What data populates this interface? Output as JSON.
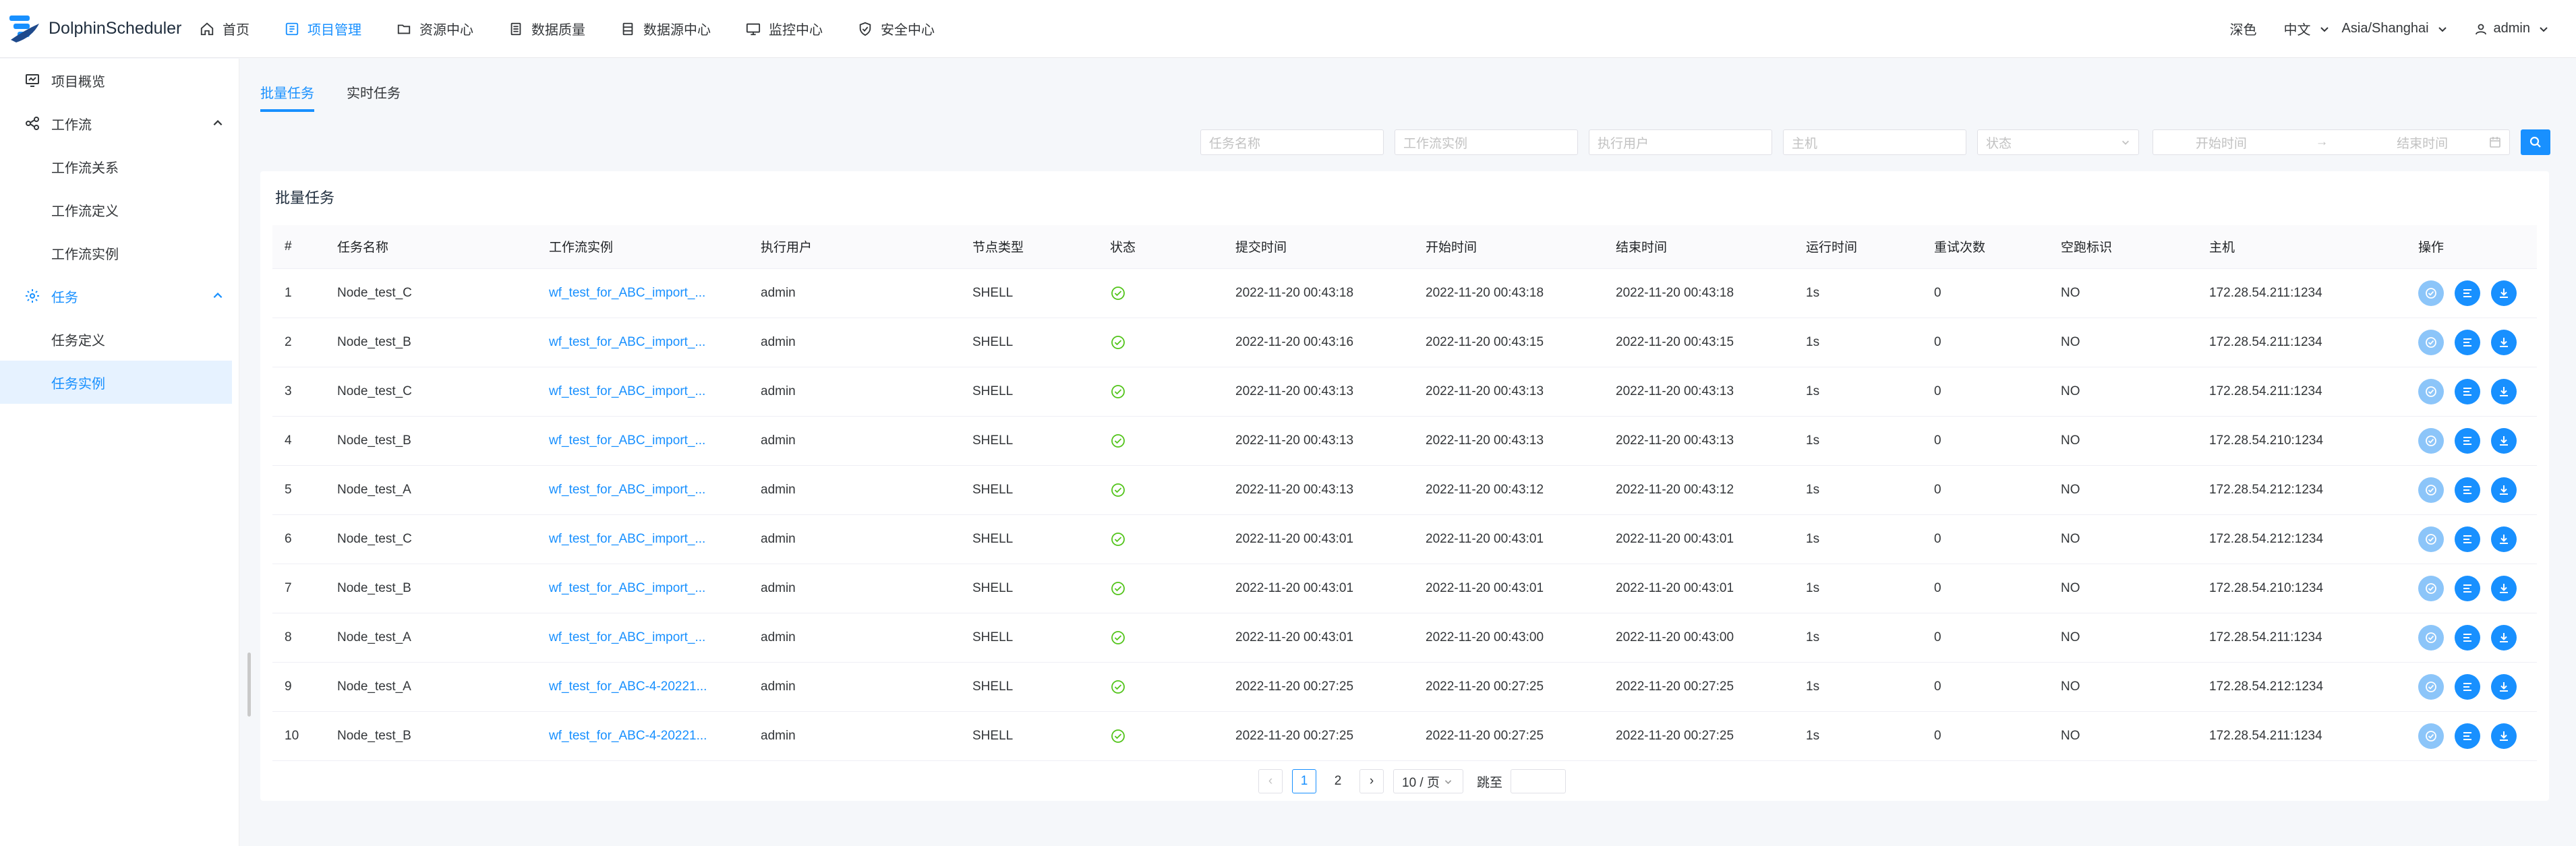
{
  "app": {
    "name": "DolphinScheduler"
  },
  "topnav": {
    "items": [
      {
        "label": "首页",
        "icon": "home-icon"
      },
      {
        "label": "项目管理",
        "icon": "project-icon",
        "active": true
      },
      {
        "label": "资源中心",
        "icon": "folder-icon"
      },
      {
        "label": "数据质量",
        "icon": "data-quality-icon"
      },
      {
        "label": "数据源中心",
        "icon": "datasource-icon"
      },
      {
        "label": "监控中心",
        "icon": "monitor-icon"
      },
      {
        "label": "安全中心",
        "icon": "security-icon"
      }
    ],
    "theme": "深色",
    "language": "中文",
    "timezone": "Asia/Shanghai",
    "user": "admin"
  },
  "sidebar": {
    "overview": "项目概览",
    "workflow": {
      "label": "工作流",
      "items": [
        "工作流关系",
        "工作流定义",
        "工作流实例"
      ]
    },
    "task": {
      "label": "任务",
      "items": [
        "任务定义",
        "任务实例"
      ],
      "active_item": "任务实例"
    }
  },
  "tabs": [
    {
      "label": "批量任务",
      "active": true
    },
    {
      "label": "实时任务",
      "active": false
    }
  ],
  "filters": {
    "task_name": "任务名称",
    "workflow_instance": "工作流实例",
    "executor": "执行用户",
    "host": "主机",
    "state": "状态",
    "start_time": "开始时间",
    "range_arrow": "→",
    "end_time": "结束时间"
  },
  "card": {
    "title": "批量任务"
  },
  "table": {
    "columns": [
      "#",
      "任务名称",
      "工作流实例",
      "执行用户",
      "节点类型",
      "状态",
      "提交时间",
      "开始时间",
      "结束时间",
      "运行时间",
      "重试次数",
      "空跑标识",
      "主机",
      "操作"
    ],
    "rows": [
      [
        "1",
        "Node_test_C",
        "wf_test_for_ABC_import_...",
        "admin",
        "SHELL",
        "2022-11-20 00:43:18",
        "2022-11-20 00:43:18",
        "2022-11-20 00:43:18",
        "1s",
        "0",
        "NO",
        "172.28.54.211:1234"
      ],
      [
        "2",
        "Node_test_B",
        "wf_test_for_ABC_import_...",
        "admin",
        "SHELL",
        "2022-11-20 00:43:16",
        "2022-11-20 00:43:15",
        "2022-11-20 00:43:15",
        "1s",
        "0",
        "NO",
        "172.28.54.211:1234"
      ],
      [
        "3",
        "Node_test_C",
        "wf_test_for_ABC_import_...",
        "admin",
        "SHELL",
        "2022-11-20 00:43:13",
        "2022-11-20 00:43:13",
        "2022-11-20 00:43:13",
        "1s",
        "0",
        "NO",
        "172.28.54.211:1234"
      ],
      [
        "4",
        "Node_test_B",
        "wf_test_for_ABC_import_...",
        "admin",
        "SHELL",
        "2022-11-20 00:43:13",
        "2022-11-20 00:43:13",
        "2022-11-20 00:43:13",
        "1s",
        "0",
        "NO",
        "172.28.54.210:1234"
      ],
      [
        "5",
        "Node_test_A",
        "wf_test_for_ABC_import_...",
        "admin",
        "SHELL",
        "2022-11-20 00:43:13",
        "2022-11-20 00:43:12",
        "2022-11-20 00:43:12",
        "1s",
        "0",
        "NO",
        "172.28.54.212:1234"
      ],
      [
        "6",
        "Node_test_C",
        "wf_test_for_ABC_import_...",
        "admin",
        "SHELL",
        "2022-11-20 00:43:01",
        "2022-11-20 00:43:01",
        "2022-11-20 00:43:01",
        "1s",
        "0",
        "NO",
        "172.28.54.212:1234"
      ],
      [
        "7",
        "Node_test_B",
        "wf_test_for_ABC_import_...",
        "admin",
        "SHELL",
        "2022-11-20 00:43:01",
        "2022-11-20 00:43:01",
        "2022-11-20 00:43:01",
        "1s",
        "0",
        "NO",
        "172.28.54.210:1234"
      ],
      [
        "8",
        "Node_test_A",
        "wf_test_for_ABC_import_...",
        "admin",
        "SHELL",
        "2022-11-20 00:43:01",
        "2022-11-20 00:43:00",
        "2022-11-20 00:43:00",
        "1s",
        "0",
        "NO",
        "172.28.54.211:1234"
      ],
      [
        "9",
        "Node_test_A",
        "wf_test_for_ABC-4-20221...",
        "admin",
        "SHELL",
        "2022-11-20 00:27:25",
        "2022-11-20 00:27:25",
        "2022-11-20 00:27:25",
        "1s",
        "0",
        "NO",
        "172.28.54.212:1234"
      ],
      [
        "10",
        "Node_test_B",
        "wf_test_for_ABC-4-20221...",
        "admin",
        "SHELL",
        "2022-11-20 00:27:25",
        "2022-11-20 00:27:25",
        "2022-11-20 00:27:25",
        "1s",
        "0",
        "NO",
        "172.28.54.211:1234"
      ]
    ],
    "status_icon": "success-check-icon",
    "action_icons": [
      "force-success-icon",
      "view-log-icon",
      "download-log-icon"
    ]
  },
  "pagination": {
    "prev": "‹",
    "pages": [
      "1",
      "2"
    ],
    "current": "1",
    "next": "›",
    "page_size": "10 / 页",
    "jump_label": "跳至"
  },
  "colors": {
    "primary": "#1890ff",
    "success": "#52c41a",
    "disabled_button": "#8cc5f9",
    "active_row_bg": "#e6f2ff"
  }
}
